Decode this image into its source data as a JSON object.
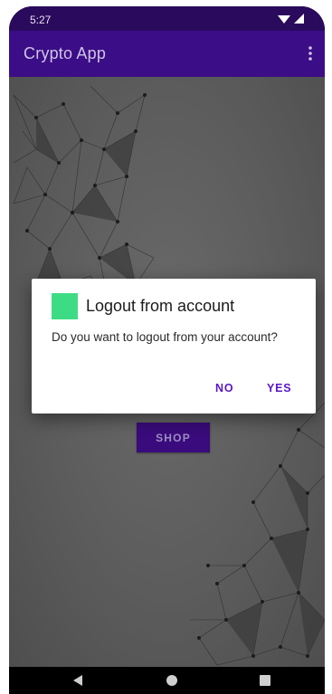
{
  "status_bar": {
    "time": "5:27",
    "icons": [
      "wifi-icon",
      "signal-icon"
    ]
  },
  "app_bar": {
    "title": "Crypto App",
    "menu_icon": "more-vert-icon",
    "color": "#3b0d86"
  },
  "main": {
    "shop_label": "SHOP"
  },
  "dialog": {
    "icon": "app-icon",
    "icon_color": "#3ddc84",
    "title": "Logout from account",
    "message": "Do you want to logout from your account?",
    "no_label": "NO",
    "yes_label": "YES",
    "button_color": "#5a16c8"
  },
  "nav_bar": {
    "icons": [
      "back-icon",
      "home-icon",
      "recents-icon"
    ]
  }
}
